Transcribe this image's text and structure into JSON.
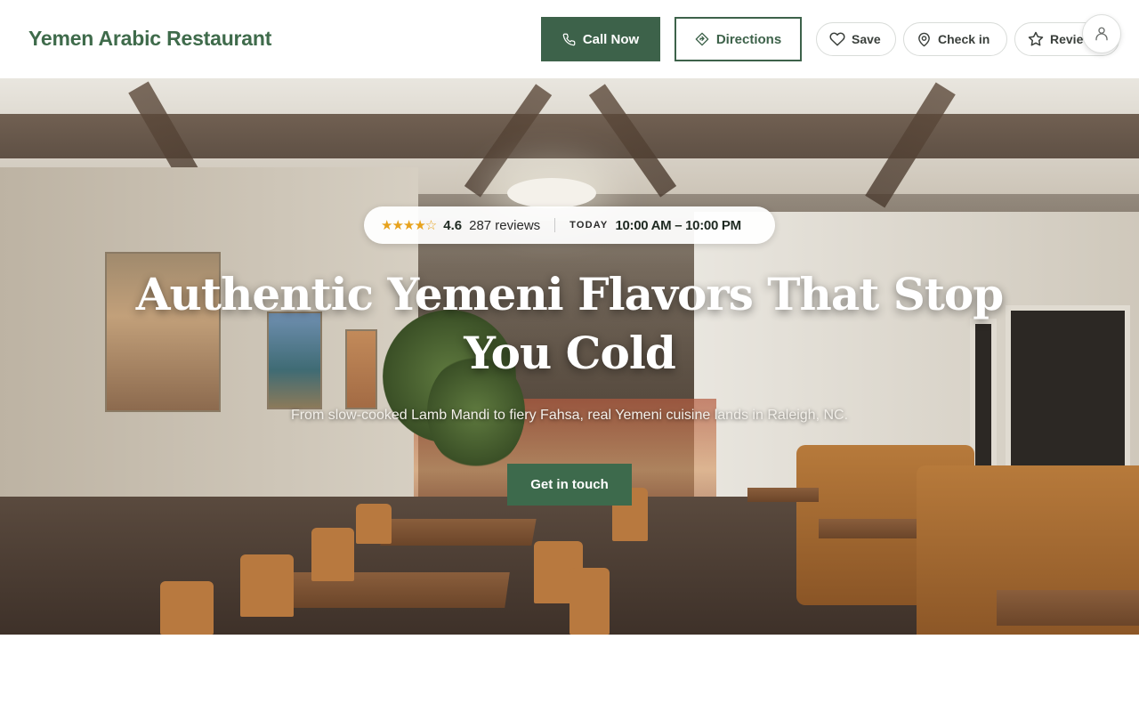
{
  "header": {
    "brand": "Yemen Arabic Restaurant",
    "call_label": "Call Now",
    "directions_label": "Directions",
    "save_label": "Save",
    "checkin_label": "Check in",
    "review_label": "Review"
  },
  "hero": {
    "badge": {
      "stars": "★★★★☆",
      "rating": "4.6",
      "reviews": "287 reviews",
      "today_label": "TODAY",
      "hours": "10:00 AM – 10:00 PM"
    },
    "headline": "Authentic Yemeni Flavors That Stop You Cold",
    "subheadline": "From slow-cooked Lamb Mandi to fiery Fahsa, real Yemeni cuisine lands in Raleigh, NC.",
    "cta_label": "Get in touch"
  },
  "colors": {
    "brand_green": "#3d624a",
    "star_gold": "#e7a21c"
  },
  "icons": {
    "call": "phone-icon",
    "directions": "directions-icon",
    "save": "heart-icon",
    "checkin": "map-pin-icon",
    "review": "star-icon",
    "account": "user-icon"
  }
}
